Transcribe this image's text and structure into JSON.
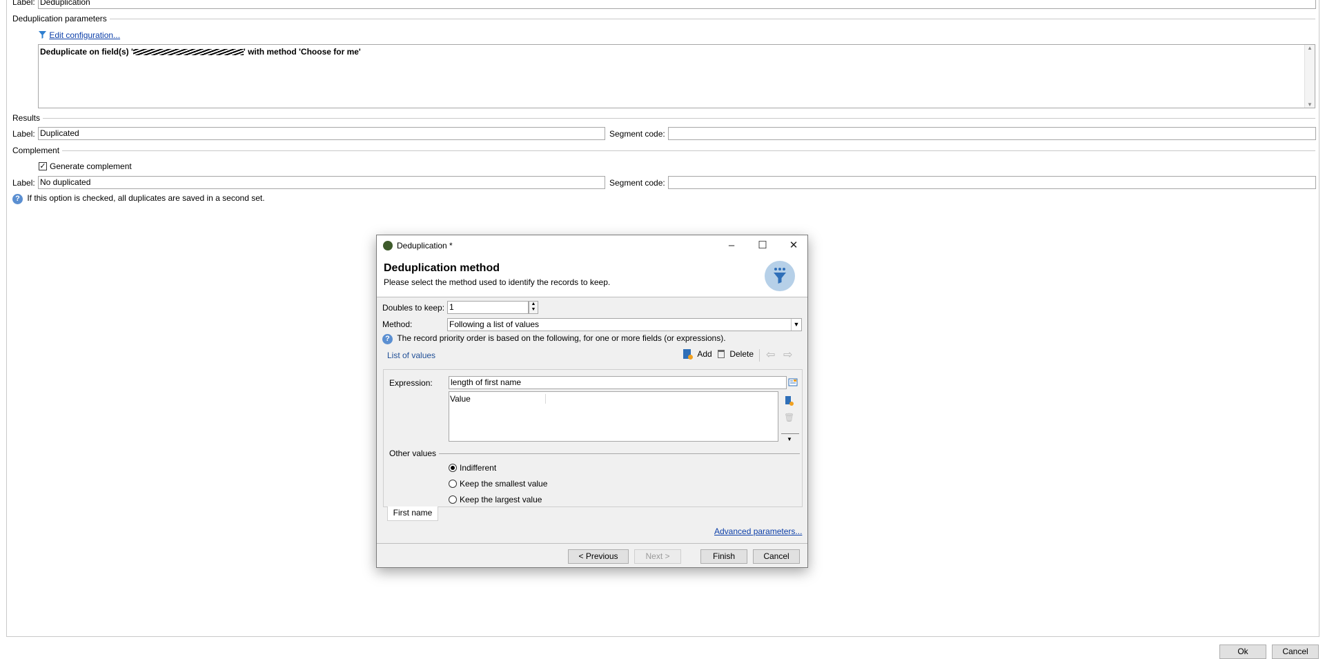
{
  "main": {
    "label_label": "Label:",
    "label_value": "Deduplication",
    "dedup_section": "Deduplication parameters",
    "edit_config_link": "Edit configuration...",
    "summary_text": "Deduplicate on field(s) '",
    "summary_text_end": "' with method 'Choose for me'",
    "results_section": "Results",
    "results_label_label": "Label:",
    "results_label_value": "Duplicated",
    "results_segment_label": "Segment code:",
    "results_segment_value": "",
    "complement_section": "Complement",
    "generate_complement": "Generate complement",
    "generate_complement_checked": true,
    "complement_label_label": "Label:",
    "complement_label_value": "No duplicated",
    "complement_segment_label": "Segment code:",
    "complement_segment_value": "",
    "help_text": "If this option is checked, all duplicates are saved in a second set.",
    "ok_button": "Ok",
    "cancel_button": "Cancel"
  },
  "dialog": {
    "title": "Deduplication *",
    "heading": "Deduplication method",
    "subheading": "Please select the method used to identify the records to keep.",
    "doubles_label": "Doubles to keep:",
    "doubles_value": "1",
    "method_label": "Method:",
    "method_value": "Following a list of values",
    "info_text": "The record priority order is based on the following, for one or more fields (or expressions).",
    "list_title": "List of values",
    "add_button": "Add",
    "delete_button": "Delete",
    "expression_label": "Expression:",
    "expression_value": "length of first name",
    "value_column": "Value",
    "other_values_label": "Other values",
    "radio_options": [
      "Indifferent",
      "Keep the smallest value",
      "Keep the largest value"
    ],
    "radio_selected": 0,
    "tab_label": "First name",
    "advanced_link": "Advanced parameters...",
    "previous_button": "< Previous",
    "next_button": "Next >",
    "finish_button": "Finish",
    "cancel_button": "Cancel"
  },
  "colors": {
    "link": "#0b3ea8",
    "help_icon": "#5b8fd1",
    "header_icon_bg": "#b6d0e8"
  }
}
